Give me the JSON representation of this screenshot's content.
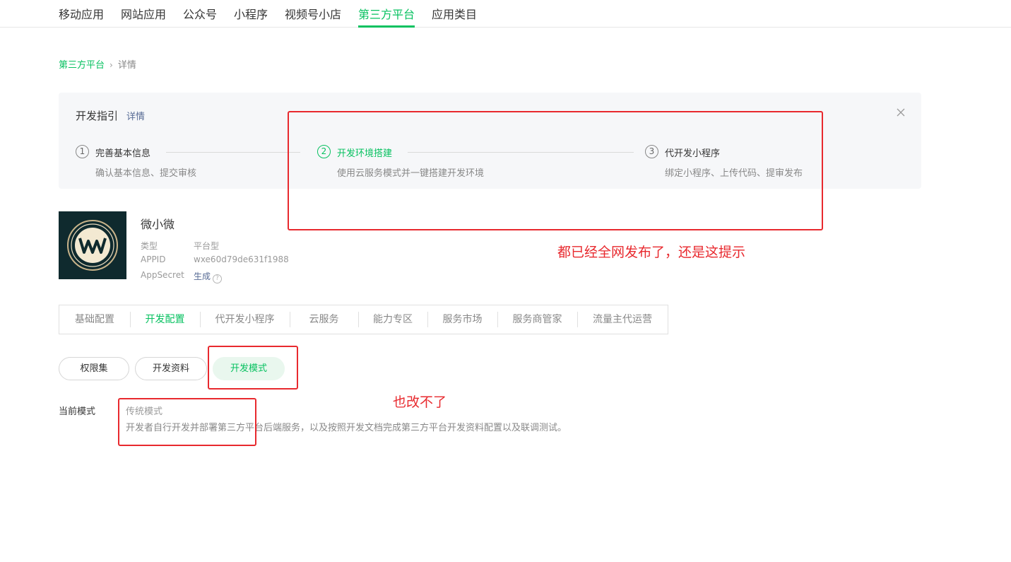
{
  "top_nav": {
    "items": [
      {
        "label": "移动应用"
      },
      {
        "label": "网站应用"
      },
      {
        "label": "公众号"
      },
      {
        "label": "小程序"
      },
      {
        "label": "视频号小店"
      },
      {
        "label": "第三方平台"
      },
      {
        "label": "应用类目"
      }
    ],
    "active_index": 5
  },
  "breadcrumb": {
    "parent": "第三方平台",
    "separator": "›",
    "current": "详情"
  },
  "guide": {
    "title": "开发指引",
    "detail_link": "详情",
    "close_icon": "close-icon",
    "steps": [
      {
        "number": "1",
        "name": "完善基本信息",
        "desc": "确认基本信息、提交审核"
      },
      {
        "number": "2",
        "name": "开发环境搭建",
        "desc": "使用云服务模式并一键搭建开发环境"
      },
      {
        "number": "3",
        "name": "代开发小程序",
        "desc": "绑定小程序、上传代码、提审发布"
      }
    ],
    "active_step": 2
  },
  "app": {
    "name": "微小微",
    "logo_icon": "app-logo-icon",
    "type_label": "类型",
    "type_value": "平台型",
    "appid_label": "APPID",
    "appid_value": "wxe60d79de631f1988",
    "secret_label": "AppSecret",
    "secret_action": "生成",
    "help_glyph": "?"
  },
  "tabs": {
    "items": [
      {
        "label": "基础配置"
      },
      {
        "label": "开发配置"
      },
      {
        "label": "代开发小程序"
      },
      {
        "label": "云服务"
      },
      {
        "label": "能力专区"
      },
      {
        "label": "服务市场"
      },
      {
        "label": "服务商管家"
      },
      {
        "label": "流量主代运营"
      }
    ],
    "active_index": 1
  },
  "pills": {
    "items": [
      {
        "label": "权限集"
      },
      {
        "label": "开发资料"
      },
      {
        "label": "开发模式"
      }
    ],
    "active_index": 2
  },
  "mode": {
    "label": "当前模式",
    "name": "传统模式",
    "description": "开发者自行开发并部署第三方平台后端服务，以及按照开发文档完成第三方平台开发资料配置以及联调测试。"
  },
  "annotations": {
    "note1": "都已经全网发布了，还是这提示",
    "note2": "也改不了"
  },
  "colors": {
    "accent": "#07c160",
    "link": "#576b95",
    "annotation": "#e8292e"
  }
}
